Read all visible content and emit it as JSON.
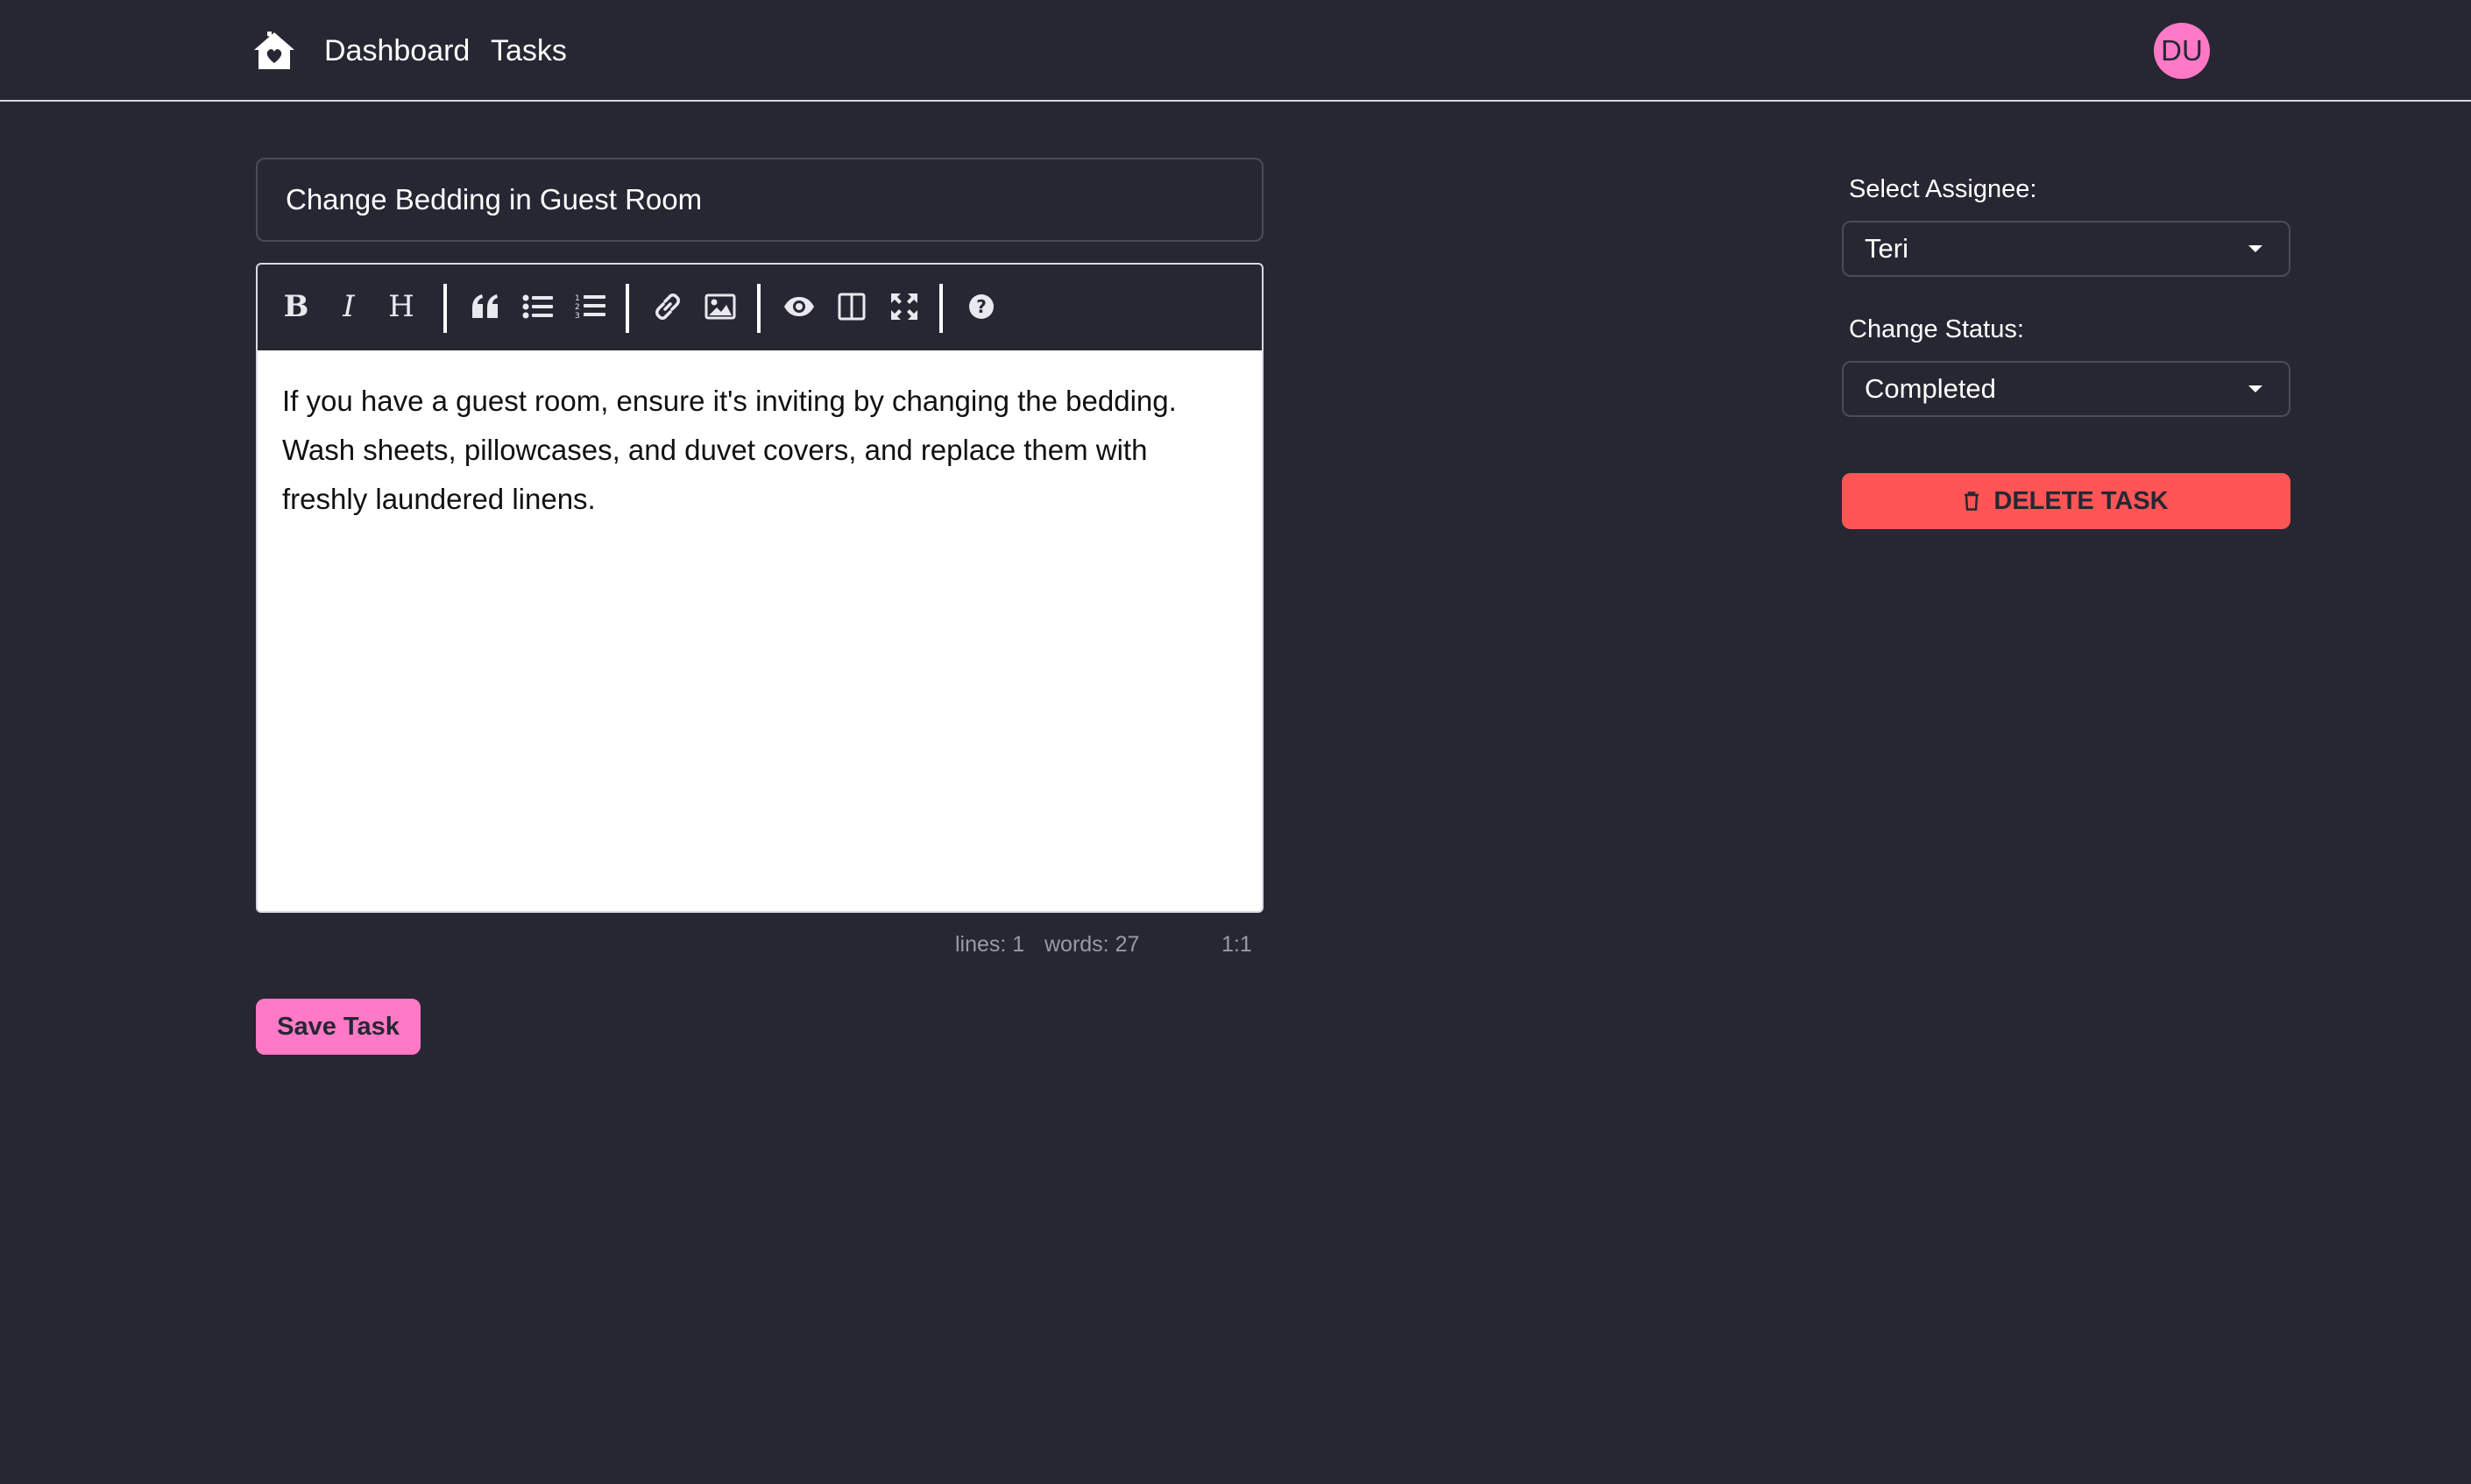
{
  "nav": {
    "home_icon": "home-heart-icon",
    "dashboard_label": "Dashboard",
    "tasks_label": "Tasks",
    "avatar_initials": "DU"
  },
  "task": {
    "title": "Change Bedding in Guest Room",
    "description": "If you have a guest room, ensure it's inviting by changing the bedding. Wash sheets, pillowcases, and duvet covers, and replace them with freshly laundered linens."
  },
  "editor": {
    "toolbar": [
      {
        "name": "bold",
        "label": "B"
      },
      {
        "name": "italic",
        "label": "I"
      },
      {
        "name": "heading",
        "label": "H"
      },
      {
        "name": "quote",
        "icon": "quote-icon"
      },
      {
        "name": "unordered-list",
        "icon": "bullet-list-icon"
      },
      {
        "name": "ordered-list",
        "icon": "numbered-list-icon"
      },
      {
        "name": "link",
        "icon": "link-icon"
      },
      {
        "name": "image",
        "icon": "image-icon"
      },
      {
        "name": "preview",
        "icon": "eye-icon"
      },
      {
        "name": "side-by-side",
        "icon": "columns-icon"
      },
      {
        "name": "fullscreen",
        "icon": "fullscreen-icon"
      },
      {
        "name": "guide",
        "icon": "help-icon"
      }
    ],
    "status": {
      "lines": "lines: 1",
      "words": "words: 27",
      "cursor": "1:1"
    }
  },
  "actions": {
    "save_label": "Save Task",
    "delete_label": "DELETE TASK",
    "delete_icon": "trash-icon"
  },
  "sidebar": {
    "assignee_label": "Select Assignee:",
    "assignee_value": "Teri",
    "status_label": "Change Status:",
    "status_value": "Completed"
  },
  "colors": {
    "background": "#262733",
    "accent_pink": "#ff79c6",
    "danger_red": "#ff5555",
    "text": "#ffffff"
  }
}
